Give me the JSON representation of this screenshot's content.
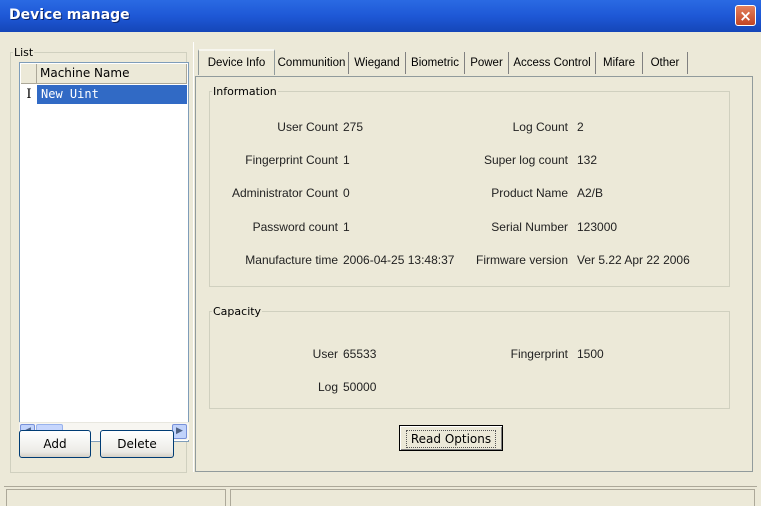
{
  "window": {
    "title": "Device manage",
    "close_glyph": "×"
  },
  "list": {
    "group_label": "List",
    "header": "Machine Name",
    "rows": [
      {
        "indicator": "I",
        "name": "New Uint",
        "selected": true
      }
    ],
    "add_label": "Add",
    "delete_label": "Delete"
  },
  "tabs": [
    {
      "label": "Device Info",
      "active": true
    },
    {
      "label": "Communition"
    },
    {
      "label": "Wiegand"
    },
    {
      "label": "Biometric"
    },
    {
      "label": "Power"
    },
    {
      "label": "Access Control"
    },
    {
      "label": "Mifare"
    },
    {
      "label": "Other"
    }
  ],
  "information": {
    "group_label": "Information",
    "left": [
      {
        "label": "User Count",
        "value": "275"
      },
      {
        "label": "Fingerprint Count",
        "value": "1"
      },
      {
        "label": "Administrator Count",
        "value": "0"
      },
      {
        "label": "Password count",
        "value": "1"
      },
      {
        "label": "Manufacture time",
        "value": "2006-04-25 13:48:37"
      }
    ],
    "right": [
      {
        "label": "Log Count",
        "value": "2"
      },
      {
        "label": "Super log count",
        "value": "132"
      },
      {
        "label": "Product Name",
        "value": "A2/B"
      },
      {
        "label": "Serial Number",
        "value": "123000"
      },
      {
        "label": "Firmware version",
        "value": "Ver 5.22 Apr 22 2006"
      }
    ]
  },
  "capacity": {
    "group_label": "Capacity",
    "user_label": "User",
    "user_value": "65533",
    "fingerprint_label": "Fingerprint",
    "fingerprint_value": "1500",
    "log_label": "Log",
    "log_value": "50000"
  },
  "read_options_label": "Read Options",
  "status": {
    "pane1": "",
    "pane2": ""
  },
  "colors": {
    "title_bar": "#1e58d6",
    "selection": "#316ac5",
    "close_button": "#d5562f",
    "dialog_bg": "#ece9d8"
  }
}
